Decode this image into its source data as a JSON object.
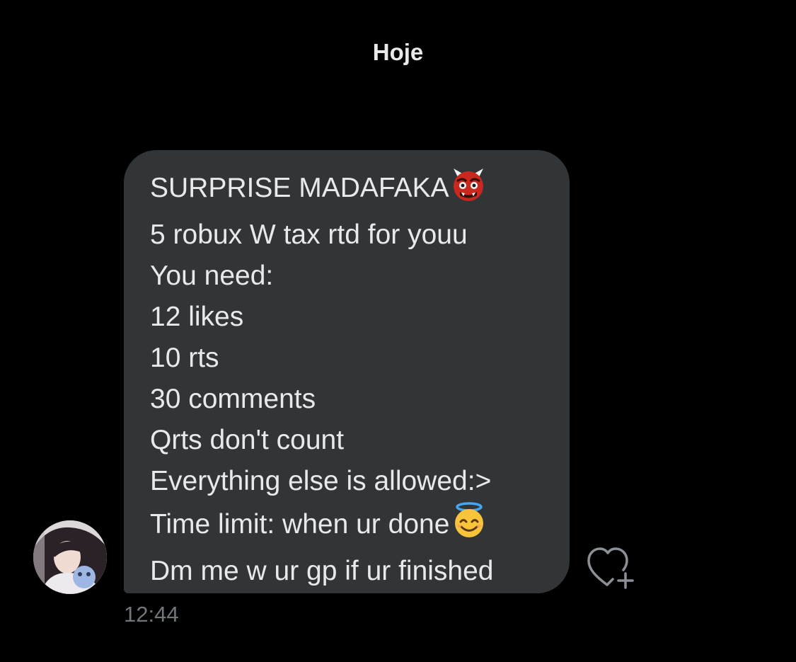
{
  "conversation": {
    "date_separator": "Hoje"
  },
  "message": {
    "lines": [
      {
        "text": "SURPRISE MADAFAKA",
        "emoji": "ogre-emoji"
      },
      {
        "text": "5 robux W tax rtd for youu"
      },
      {
        "text": "You need:"
      },
      {
        "text": "12 likes"
      },
      {
        "text": "10 rts"
      },
      {
        "text": "30 comments"
      },
      {
        "text": "Qrts don't count"
      },
      {
        "text": "Everything else is allowed:>"
      },
      {
        "text": "Time limit: when ur done",
        "emoji": "smiling-face-with-halo-emoji"
      },
      {
        "text": "Dm me w ur gp if ur finished"
      }
    ],
    "timestamp": "12:44",
    "reaction_icon": "heart-add-icon"
  },
  "colors": {
    "background": "#000000",
    "bubble": "#323538",
    "text": "#e7e9ea",
    "muted": "#71767b"
  }
}
